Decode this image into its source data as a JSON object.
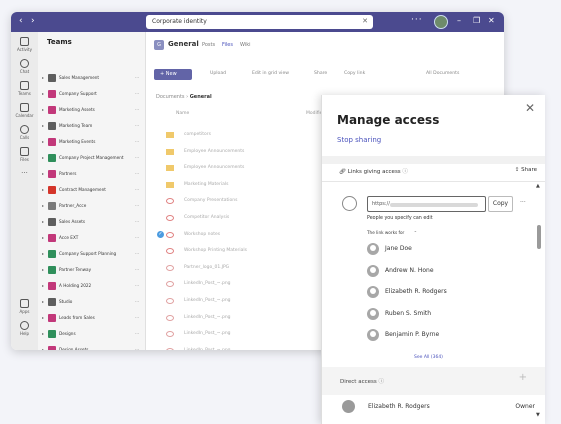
{
  "titlebar": {
    "back_icon": "arrow-left-icon",
    "forward_icon": "arrow-right-icon",
    "search_value": "Corporate identity",
    "more": "···"
  },
  "rail": [
    {
      "label": "Activity",
      "icon": "bell-icon"
    },
    {
      "label": "Chat",
      "icon": "chat-icon"
    },
    {
      "label": "Teams",
      "icon": "teams-icon"
    },
    {
      "label": "Calendar",
      "icon": "calendar-icon"
    },
    {
      "label": "Calls",
      "icon": "phone-icon"
    },
    {
      "label": "Files",
      "icon": "file-icon"
    },
    {
      "label": "···",
      "icon": "more-icon"
    },
    {
      "label": "Apps",
      "icon": "apps-icon"
    },
    {
      "label": "Help",
      "icon": "help-icon"
    }
  ],
  "teams_panel": {
    "title": "Teams",
    "items": [
      {
        "name": "Sales Management",
        "color": "#5e5e5e"
      },
      {
        "name": "Company Support",
        "color": "#c2387a"
      },
      {
        "name": "Marketing Assets",
        "color": "#c2387a"
      },
      {
        "name": "Marketing Team",
        "color": "#5e5e5e"
      },
      {
        "name": "Marketing Events",
        "color": "#c2387a"
      },
      {
        "name": "Company Project Management",
        "color": "#2f8f5b"
      },
      {
        "name": "Partners",
        "color": "#c2387a"
      },
      {
        "name": "Contract Management",
        "color": "#d4352a"
      },
      {
        "name": "Partner_Acce",
        "color": "#7a7a7a"
      },
      {
        "name": "Sales Assets",
        "color": "#5e5e5e"
      },
      {
        "name": "Acce EXT",
        "color": "#c2387a"
      },
      {
        "name": "Company Support Planning",
        "color": "#2f8f5b"
      },
      {
        "name": "Partner Tenway",
        "color": "#2f8f5b"
      },
      {
        "name": "A Holding 2022",
        "color": "#c2387a"
      },
      {
        "name": "Studio",
        "color": "#5e5e5e"
      },
      {
        "name": "Leads from Sales",
        "color": "#c2387a"
      },
      {
        "name": "Designs",
        "color": "#2f8f5b"
      },
      {
        "name": "Design Assets",
        "color": "#c2387a"
      }
    ]
  },
  "channel": {
    "initial": "G",
    "name": "General",
    "tabs": [
      "Posts",
      "Files",
      "Wiki"
    ]
  },
  "toolbar": {
    "new_label": "+ New",
    "upload": "Upload",
    "edit_grid": "Edit in grid view",
    "share": "Share",
    "copy_link": "Copy link",
    "all_documents": "All Documents"
  },
  "breadcrumb": {
    "root": "Documents",
    "current": "General"
  },
  "columns": {
    "name": "Name",
    "modified": "Modified"
  },
  "files": [
    {
      "name": "competitors",
      "kind": "folder"
    },
    {
      "name": "Employee Announcements",
      "kind": "folder"
    },
    {
      "name": "Employee Announcements",
      "kind": "folder"
    },
    {
      "name": "Marketing Materials",
      "kind": "folder"
    },
    {
      "name": "Company Presentations",
      "kind": "pdf"
    },
    {
      "name": "Competitor Analysis",
      "kind": "pdf"
    },
    {
      "name": "Workshop notes",
      "kind": "pdf"
    },
    {
      "name": "Workshop Printing Materials",
      "kind": "pdf"
    },
    {
      "name": "Partner_logo_01.JPG",
      "kind": "image"
    },
    {
      "name": "LinkedIn_Post_~.png",
      "kind": "image"
    },
    {
      "name": "LinkedIn_Post_~.png",
      "kind": "image"
    },
    {
      "name": "LinkedIn_Post_~.png",
      "kind": "image"
    },
    {
      "name": "LinkedIn_Post_~.png",
      "kind": "image"
    },
    {
      "name": "LinkedIn_Post_~.png",
      "kind": "image"
    }
  ],
  "manage_access": {
    "title": "Manage access",
    "stop_sharing": "Stop sharing",
    "links_label": "Links giving access",
    "share_label": "Share",
    "url_prefix": "https://",
    "copy_label": "Copy",
    "permission": "People you specify can edit",
    "works_for": "The link works for",
    "people": [
      "Jane Doe",
      "Andrew N. Hone",
      "Elizabeth R. Rodgers",
      "Ruben S. Smith",
      "Benjamin P. Byrne"
    ],
    "see_all": "See All (364)",
    "direct_access": "Direct access",
    "direct_person": "Elizabeth R. Rodgers",
    "direct_role": "Owner"
  }
}
